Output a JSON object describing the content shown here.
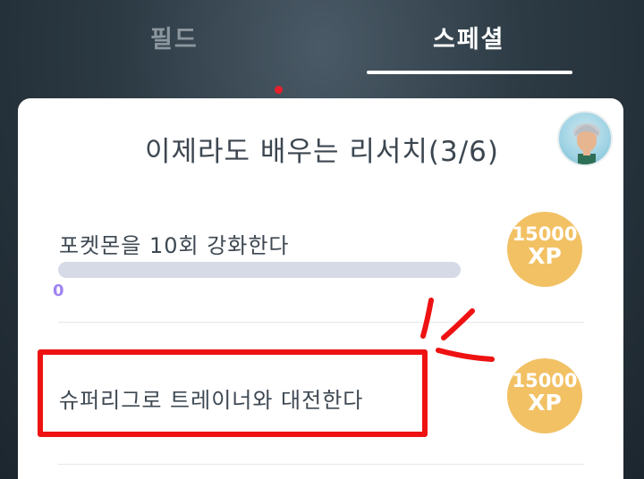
{
  "tabs": [
    {
      "label": "필드",
      "active": false
    },
    {
      "label": "스페셜",
      "active": true
    }
  ],
  "card": {
    "title": "이제라도 배우는 리서치(3/6)",
    "quests": [
      {
        "text": "포켓몬을 10회 강화한다",
        "progress_value": "0",
        "progress_fraction": 0,
        "reward_amount": "15000",
        "reward_unit": "XP"
      },
      {
        "text": "슈퍼리그로 트레이너와 대전한다",
        "reward_amount": "15000",
        "reward_unit": "XP"
      }
    ]
  },
  "colors": {
    "accent_progress": "#9f82f2",
    "xp_badge": "#f2c164",
    "highlight": "#ee1212",
    "notification": "#e8202a"
  }
}
